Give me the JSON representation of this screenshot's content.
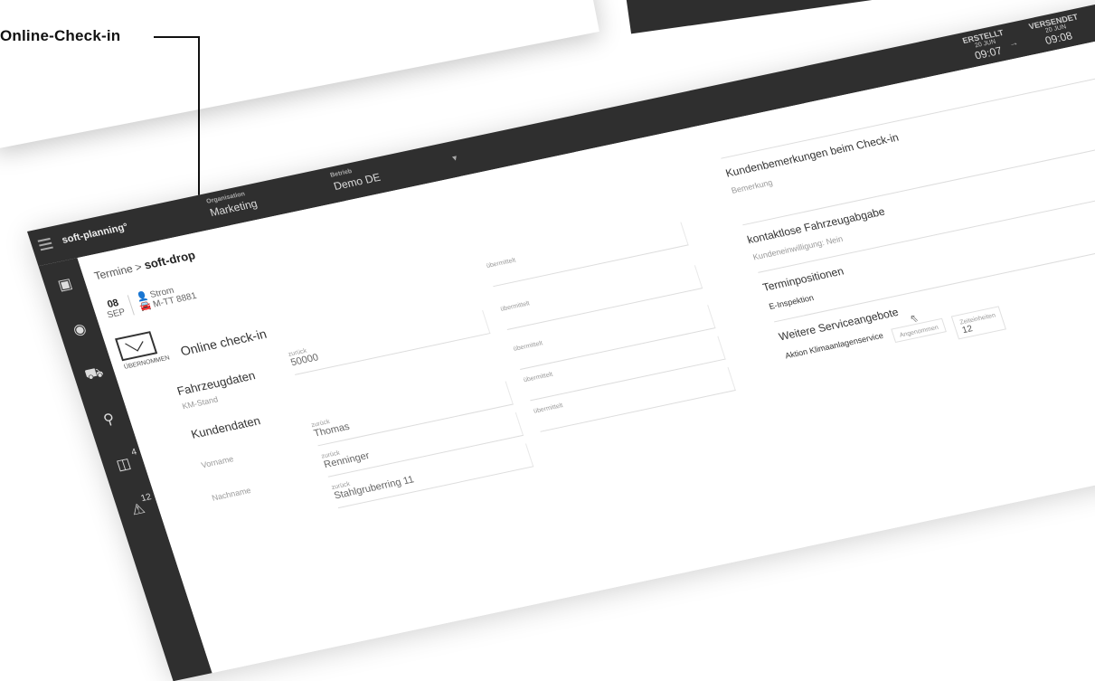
{
  "callout": {
    "label": "Online-Check-in"
  },
  "topbar": {
    "brand": "soft-planning°",
    "org_label": "Organisation",
    "org_value": "Marketing",
    "betrieb_label": "Betrieb",
    "betrieb_value": "Demo DE",
    "created_label": "ERSTELLT",
    "created_date": "20 JUN",
    "created_time": "09:07",
    "arrow": "→",
    "sent_label": "VERSENDET",
    "sent_date": "20 JUN",
    "sent_time": "09:08"
  },
  "sidebar": {
    "items": [
      {
        "icon": "calendar-icon",
        "glyph": "▣",
        "badge": ""
      },
      {
        "icon": "speedometer-icon",
        "glyph": "◉",
        "badge": ""
      },
      {
        "icon": "car-icon",
        "glyph": "⛟",
        "badge": ""
      },
      {
        "icon": "search-icon",
        "glyph": "⚲",
        "badge": ""
      },
      {
        "icon": "inbox-icon",
        "glyph": "◫",
        "badge": "4"
      },
      {
        "icon": "warning-icon",
        "glyph": "⚠",
        "badge": "12"
      }
    ]
  },
  "breadcrumb": {
    "parent": "Termine",
    "sep": ">",
    "current": "soft-drop"
  },
  "appointment": {
    "day": "08",
    "month": "SEP",
    "customer": "Strom",
    "plate": "M-TT 8881"
  },
  "checkin": {
    "status": "ÜBERNOMMEN",
    "title": "Online check-in",
    "transmitted": "übermittelt"
  },
  "vehicle": {
    "title": "Fahrzeugdaten",
    "sub": "KM-Stand",
    "field_label": "zurück",
    "field_value": "50000",
    "transmitted": "übermittelt"
  },
  "customer": {
    "title": "Kundendaten",
    "rows": [
      {
        "label": "Vorname",
        "field_label": "zurück",
        "value": "Thomas",
        "transmitted": "übermittelt"
      },
      {
        "label": "Nachname",
        "field_label": "zurück",
        "value": "Renninger",
        "transmitted": "übermittelt"
      },
      {
        "label": "",
        "field_label": "zurück",
        "value": "Stahlgruberring 11",
        "transmitted": "übermittelt"
      }
    ]
  },
  "right": {
    "remarks_title": "Kundenbemerkungen beim Check-in",
    "remarks_sub": "Bemerkung",
    "contactless_title": "kontaktlose Fahrzeugabgabe",
    "contactless_sub": "Kundeneinwilligung: Nein",
    "positions_title": "Terminpositionen",
    "positions_item": "E-Inspektion",
    "services_title": "Weitere Serviceangebote",
    "service_item": "Aktion Klimaanlagenservice",
    "accepted_label": "Angenommen",
    "units_label": "Zeiteinheiten",
    "units_value": "12"
  }
}
